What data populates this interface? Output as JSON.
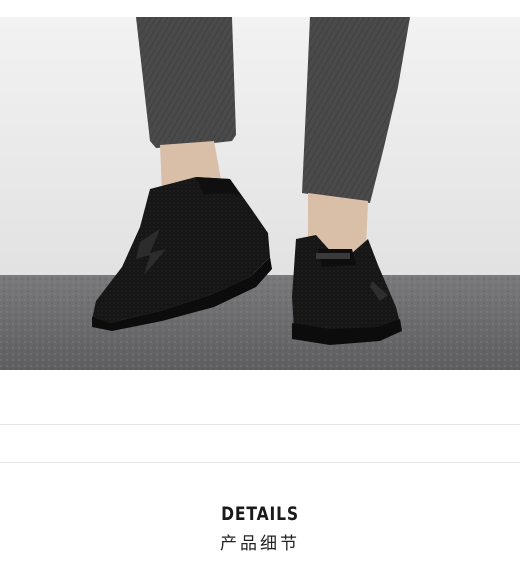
{
  "product_image": {
    "subject": "black-sneakers-photo",
    "colors": {
      "wall": "#ececec",
      "floor": "#6e6e70",
      "shoe": "#141414",
      "jeans": "#4a4a4a"
    }
  },
  "details_section": {
    "title": "DETAILS",
    "subtitle": "产品细节"
  }
}
